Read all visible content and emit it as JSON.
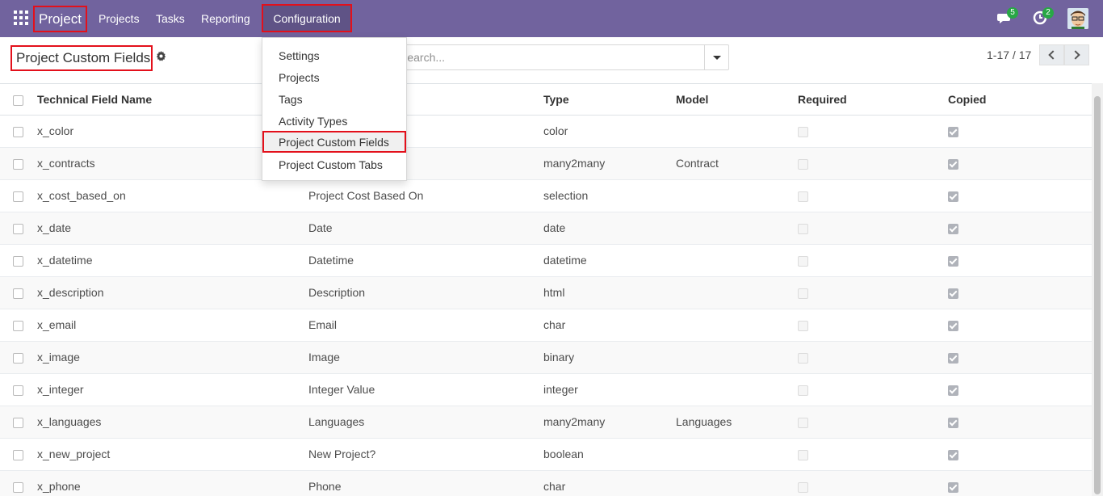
{
  "navbar": {
    "brand": "Project",
    "menus": [
      "Projects",
      "Tasks",
      "Reporting"
    ],
    "configuration": "Configuration",
    "messages_count": "5",
    "activities_count": "2",
    "accent": "#71639e"
  },
  "config_menu": {
    "items": [
      "Settings",
      "Projects",
      "Tags",
      "Activity Types",
      "Project Custom Fields",
      "Project Custom Tabs"
    ],
    "active": "Project Custom Fields"
  },
  "control_panel": {
    "breadcrumb": "Project Custom Fields",
    "search_placeholder": "Search...",
    "pager": "1-17 / 17"
  },
  "table": {
    "columns": [
      "Technical Field Name",
      "",
      "Type",
      "Model",
      "Required",
      "Copied"
    ],
    "rows": [
      {
        "name": "x_color",
        "label": "",
        "type": "color",
        "model": "",
        "required": false,
        "copied": true
      },
      {
        "name": "x_contracts",
        "label": "",
        "type": "many2many",
        "model": "Contract",
        "required": false,
        "copied": true
      },
      {
        "name": "x_cost_based_on",
        "label": "Project Cost Based On",
        "type": "selection",
        "model": "",
        "required": false,
        "copied": true
      },
      {
        "name": "x_date",
        "label": "Date",
        "type": "date",
        "model": "",
        "required": false,
        "copied": true
      },
      {
        "name": "x_datetime",
        "label": "Datetime",
        "type": "datetime",
        "model": "",
        "required": false,
        "copied": true
      },
      {
        "name": "x_description",
        "label": "Description",
        "type": "html",
        "model": "",
        "required": false,
        "copied": true
      },
      {
        "name": "x_email",
        "label": "Email",
        "type": "char",
        "model": "",
        "required": false,
        "copied": true
      },
      {
        "name": "x_image",
        "label": "Image",
        "type": "binary",
        "model": "",
        "required": false,
        "copied": true
      },
      {
        "name": "x_integer",
        "label": "Integer Value",
        "type": "integer",
        "model": "",
        "required": false,
        "copied": true
      },
      {
        "name": "x_languages",
        "label": "Languages",
        "type": "many2many",
        "model": "Languages",
        "required": false,
        "copied": true
      },
      {
        "name": "x_new_project",
        "label": "New Project?",
        "type": "boolean",
        "model": "",
        "required": false,
        "copied": true
      },
      {
        "name": "x_phone",
        "label": "Phone",
        "type": "char",
        "model": "",
        "required": false,
        "copied": true
      }
    ]
  }
}
